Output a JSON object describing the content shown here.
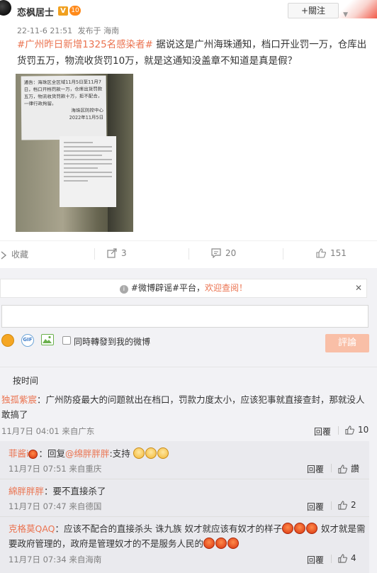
{
  "post": {
    "username": "恋枫居士",
    "v_badge": "V",
    "rank_badge": "10",
    "follow_label": "+關注",
    "timestamp": "22-11-6 21:51",
    "source": "发布于 海南",
    "hashtag": "#广州昨日新增1325名感染者#",
    "text": " 据说这是广州海珠通知，档口开业罚一万，仓库出货罚五万，物流收货罚10万，就是这通知没盖章不知道是真是假？",
    "photo_notice_text": "通告：海珠区全区域11月5日至11月7日，档口开档罚款一万，仓库出货罚款五万，物流收货罚款十万，拒不配合，一律行政拘留。",
    "photo_notice_sign": "海珠区防控中心",
    "photo_notice_date": "2022年11月5日"
  },
  "actions": {
    "favorite_label": "收藏",
    "repost_count": "3",
    "comment_count": "20",
    "like_count": "151"
  },
  "comment_panel": {
    "notice_prefix": "#微博辟谣#平台，",
    "notice_link": "欢迎查阅！",
    "close_icon": "✕",
    "repost_checkbox_label": "同時轉發到我的微博",
    "comment_button": "評論",
    "sort_label": "按时间"
  },
  "comments": [
    {
      "user": "独孤紫宸",
      "text": "：广州防疫最大的问题就出在档口，罚款力度太小，应该犯事就直接查封，那就没人敢搞了",
      "time": "11月7日 04:01 来自广东",
      "reply_label": "回覆",
      "likes": "10"
    }
  ],
  "replies": [
    {
      "user": "菲酱i",
      "reply_prefix": "：回复",
      "reply_to": "@绵胖胖胖",
      "text": ":支持",
      "time": "11月7日 07:51 来自重庆",
      "reply_label": "回覆",
      "likes": "讚"
    },
    {
      "user": "綿胖胖胖",
      "text": "：要不直接杀了",
      "time": "11月7日 07:47 来自德国",
      "reply_label": "回覆",
      "likes": "2"
    },
    {
      "user": "克格莫QAQ",
      "text_a": "：应该不配合的直接杀头 诛九族 奴才就应该有奴才的样子",
      "text_b": " 奴才就是需要政府管理的，政府是管理奴才的不是服务人民的",
      "time": "11月7日 07:34 来自海南",
      "reply_label": "回覆",
      "likes": "4"
    }
  ],
  "colors": {
    "accent": "#eb7350",
    "gray_bg": "#f2f2f5",
    "comment_button_bg": "#f9bfa7"
  }
}
